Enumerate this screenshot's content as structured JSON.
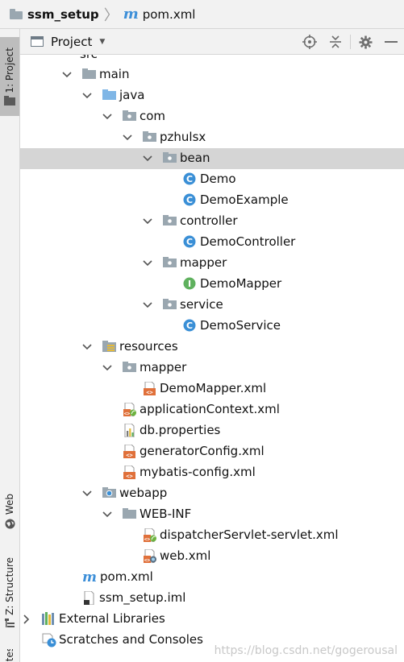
{
  "breadcrumb": {
    "project": "ssm_setup",
    "file": "pom.xml"
  },
  "sidebar": {
    "project_tab": "1: Project",
    "web_tab": "Web",
    "structure_tab": "Z: Structure",
    "bottom_tab": "ites"
  },
  "panel": {
    "title": "Project",
    "dropdown_icon": "caret-down-icon",
    "tools": [
      "locate-icon",
      "collapse-all-icon",
      "gear-icon",
      "hide-icon"
    ]
  },
  "tree": {
    "partial_top": "src",
    "items": [
      {
        "label": "main",
        "icon": "folder",
        "expanded": true
      },
      {
        "label": "java",
        "icon": "source-folder",
        "expanded": true
      },
      {
        "label": "com",
        "icon": "package",
        "expanded": true
      },
      {
        "label": "pzhulsx",
        "icon": "package",
        "expanded": true
      },
      {
        "label": "bean",
        "icon": "package",
        "expanded": true,
        "selected": true
      },
      {
        "label": "Demo",
        "icon": "class"
      },
      {
        "label": "DemoExample",
        "icon": "class"
      },
      {
        "label": "controller",
        "icon": "package",
        "expanded": true
      },
      {
        "label": "DemoController",
        "icon": "class"
      },
      {
        "label": "mapper",
        "icon": "package",
        "expanded": true
      },
      {
        "label": "DemoMapper",
        "icon": "interface"
      },
      {
        "label": "service",
        "icon": "package",
        "expanded": true
      },
      {
        "label": "DemoService",
        "icon": "class"
      },
      {
        "label": "resources",
        "icon": "resources-folder",
        "expanded": true
      },
      {
        "label": "mapper",
        "icon": "package",
        "expanded": true
      },
      {
        "label": "DemoMapper.xml",
        "icon": "xml"
      },
      {
        "label": "applicationContext.xml",
        "icon": "spring-xml"
      },
      {
        "label": "db.properties",
        "icon": "properties"
      },
      {
        "label": "generatorConfig.xml",
        "icon": "xml"
      },
      {
        "label": "mybatis-config.xml",
        "icon": "xml"
      },
      {
        "label": "webapp",
        "icon": "web-folder",
        "expanded": true
      },
      {
        "label": "WEB-INF",
        "icon": "folder",
        "expanded": true
      },
      {
        "label": "dispatcherServlet-servlet.xml",
        "icon": "spring-xml"
      },
      {
        "label": "web.xml",
        "icon": "web-xml"
      },
      {
        "label": "pom.xml",
        "icon": "maven"
      },
      {
        "label": "ssm_setup.iml",
        "icon": "iml"
      },
      {
        "label": "External Libraries",
        "icon": "libraries",
        "expanded": false
      },
      {
        "label": "Scratches and Consoles",
        "icon": "scratches"
      }
    ]
  },
  "watermark": "https://blog.csdn.net/gogerousal",
  "colors": {
    "selection": "#d5d5d5",
    "class_icon": "#3a8fd6",
    "interface_icon": "#5fb15e",
    "xml_icon": "#e0703a",
    "folder_icon": "#9aa7b0"
  }
}
